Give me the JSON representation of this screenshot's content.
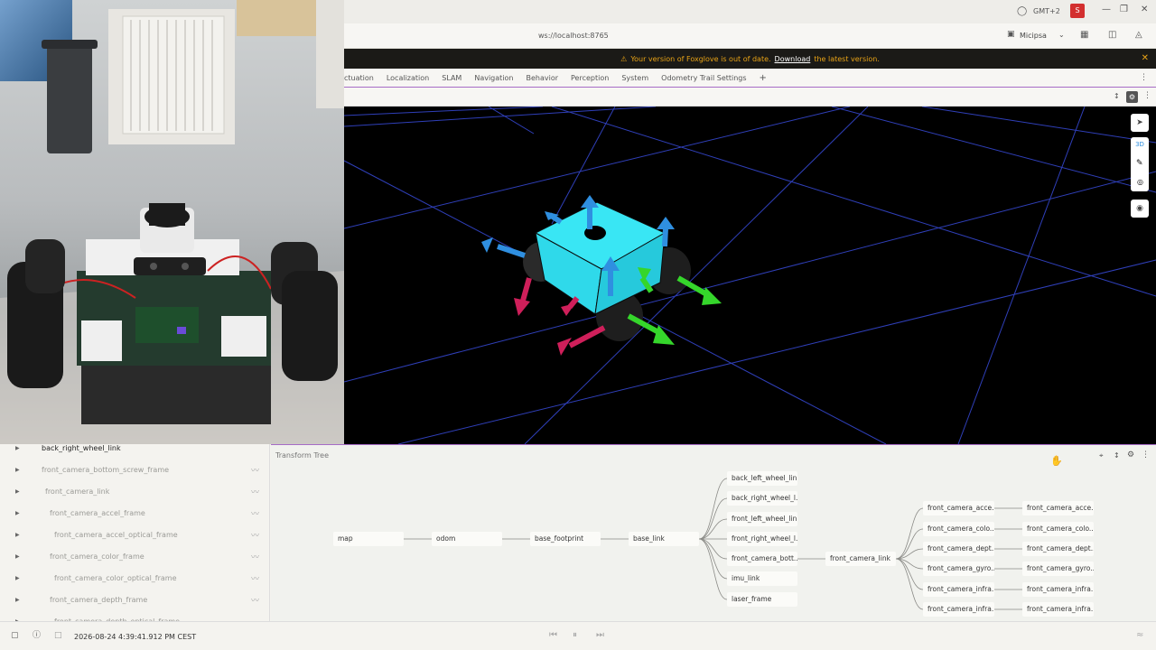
{
  "window": {
    "timezone_label": "GMT+2",
    "user_avatar": "S",
    "accent_color": "#d32f2f"
  },
  "connection": {
    "url": "ws://localhost:8765",
    "profile_name": "Micipsa"
  },
  "banner": {
    "message": "Your version of Foxglove is out of date.",
    "link": "Download",
    "suffix": "the latest version."
  },
  "tabs": [
    "ctuation",
    "Localization",
    "SLAM",
    "Navigation",
    "Behavior",
    "Perception",
    "System",
    "Odometry Trail Settings"
  ],
  "scene": {
    "toolbar_icons": [
      "select-icon",
      "3d-toggle",
      "ruler-icon",
      "publish-icon",
      "recenter-icon"
    ],
    "mode_label": "3D"
  },
  "frame_list": [
    {
      "name": "back_right_wheel_link",
      "indent": 0,
      "highlight": true
    },
    {
      "name": "front_camera_bottom_screw_frame",
      "indent": 0
    },
    {
      "name": "front_camera_link",
      "indent": 1
    },
    {
      "name": "front_camera_accel_frame",
      "indent": 2
    },
    {
      "name": "front_camera_accel_optical_frame",
      "indent": 3
    },
    {
      "name": "front_camera_color_frame",
      "indent": 2
    },
    {
      "name": "front_camera_color_optical_frame",
      "indent": 3
    },
    {
      "name": "front_camera_depth_frame",
      "indent": 2
    },
    {
      "name": "front_camera_depth_optical_frame",
      "indent": 3
    }
  ],
  "transform_tree": {
    "title": "Transform Tree",
    "chain": [
      "map",
      "odom",
      "base_footprint",
      "base_link"
    ],
    "base_link_children": [
      "back_left_wheel_link",
      "back_right_wheel_l...",
      "front_left_wheel_link",
      "front_right_wheel_l...",
      "front_camera_bott...",
      "imu_link",
      "laser_frame"
    ],
    "camera_link": "front_camera_link",
    "camera_children": [
      "front_camera_acce...",
      "front_camera_colo...",
      "front_camera_dept...",
      "front_camera_gyro...",
      "front_camera_infra...",
      "front_camera_infra..."
    ],
    "camera_grandchildren": [
      "front_camera_acce...",
      "front_camera_colo...",
      "front_camera_dept...",
      "front_camera_gyro...",
      "front_camera_infra...",
      "front_camera_infra..."
    ]
  },
  "status": {
    "timestamp": "2026-08-24 4:39:41.912 PM CEST"
  }
}
